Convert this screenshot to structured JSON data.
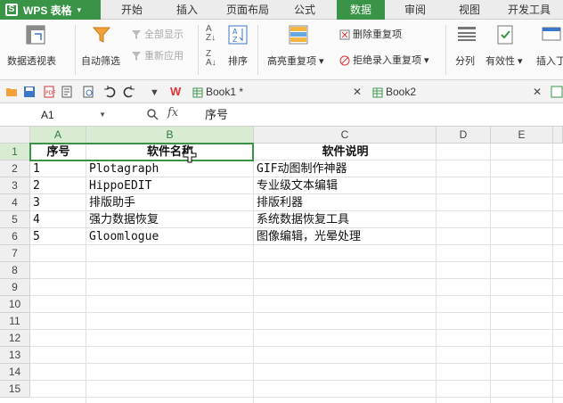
{
  "app": {
    "name": "WPS 表格",
    "logo": "S"
  },
  "menu": {
    "items": [
      "开始",
      "插入",
      "页面布局",
      "公式",
      "数据",
      "审阅",
      "视图",
      "开发工具"
    ],
    "active": "数据"
  },
  "ribbon": {
    "pivot": "数据透视表",
    "autofilter": "自动筛选",
    "show_all": "全部显示",
    "reapply": "重新应用",
    "sort": "排序",
    "highlight_dup": "高亮重复项",
    "delete_dup": "删除重复项",
    "reject_dup": "拒绝录入重复项",
    "split": "分列",
    "validity": "有效性",
    "insert": "插入丁"
  },
  "qat": {
    "wps_mark": "W",
    "tabs": [
      "Book1 *",
      "Book2"
    ],
    "more": "▼"
  },
  "formula_bar": {
    "cell_ref": "A1",
    "fx": "fx",
    "content": "序号"
  },
  "columns": [
    "A",
    "B",
    "C",
    "D",
    "E"
  ],
  "rows": [
    "1",
    "2",
    "3",
    "4",
    "5",
    "6",
    "7",
    "8",
    "9",
    "10",
    "11",
    "12",
    "13",
    "14",
    "15"
  ],
  "table": {
    "headers": [
      "序号",
      "软件名称",
      "软件说明"
    ],
    "rows": [
      [
        "1",
        "Plotagraph",
        "GIF动图制作神器"
      ],
      [
        "2",
        "HippoEDIT",
        "专业级文本编辑"
      ],
      [
        "3",
        "排版助手",
        "排版利器"
      ],
      [
        "4",
        "强力数据恢复",
        "系统数据恢复工具"
      ],
      [
        "5",
        "Gloomlogue",
        "图像编辑，光晕处理"
      ]
    ]
  },
  "colors": {
    "accent": "#3a9448",
    "selection_header": "#d9ebd3"
  }
}
